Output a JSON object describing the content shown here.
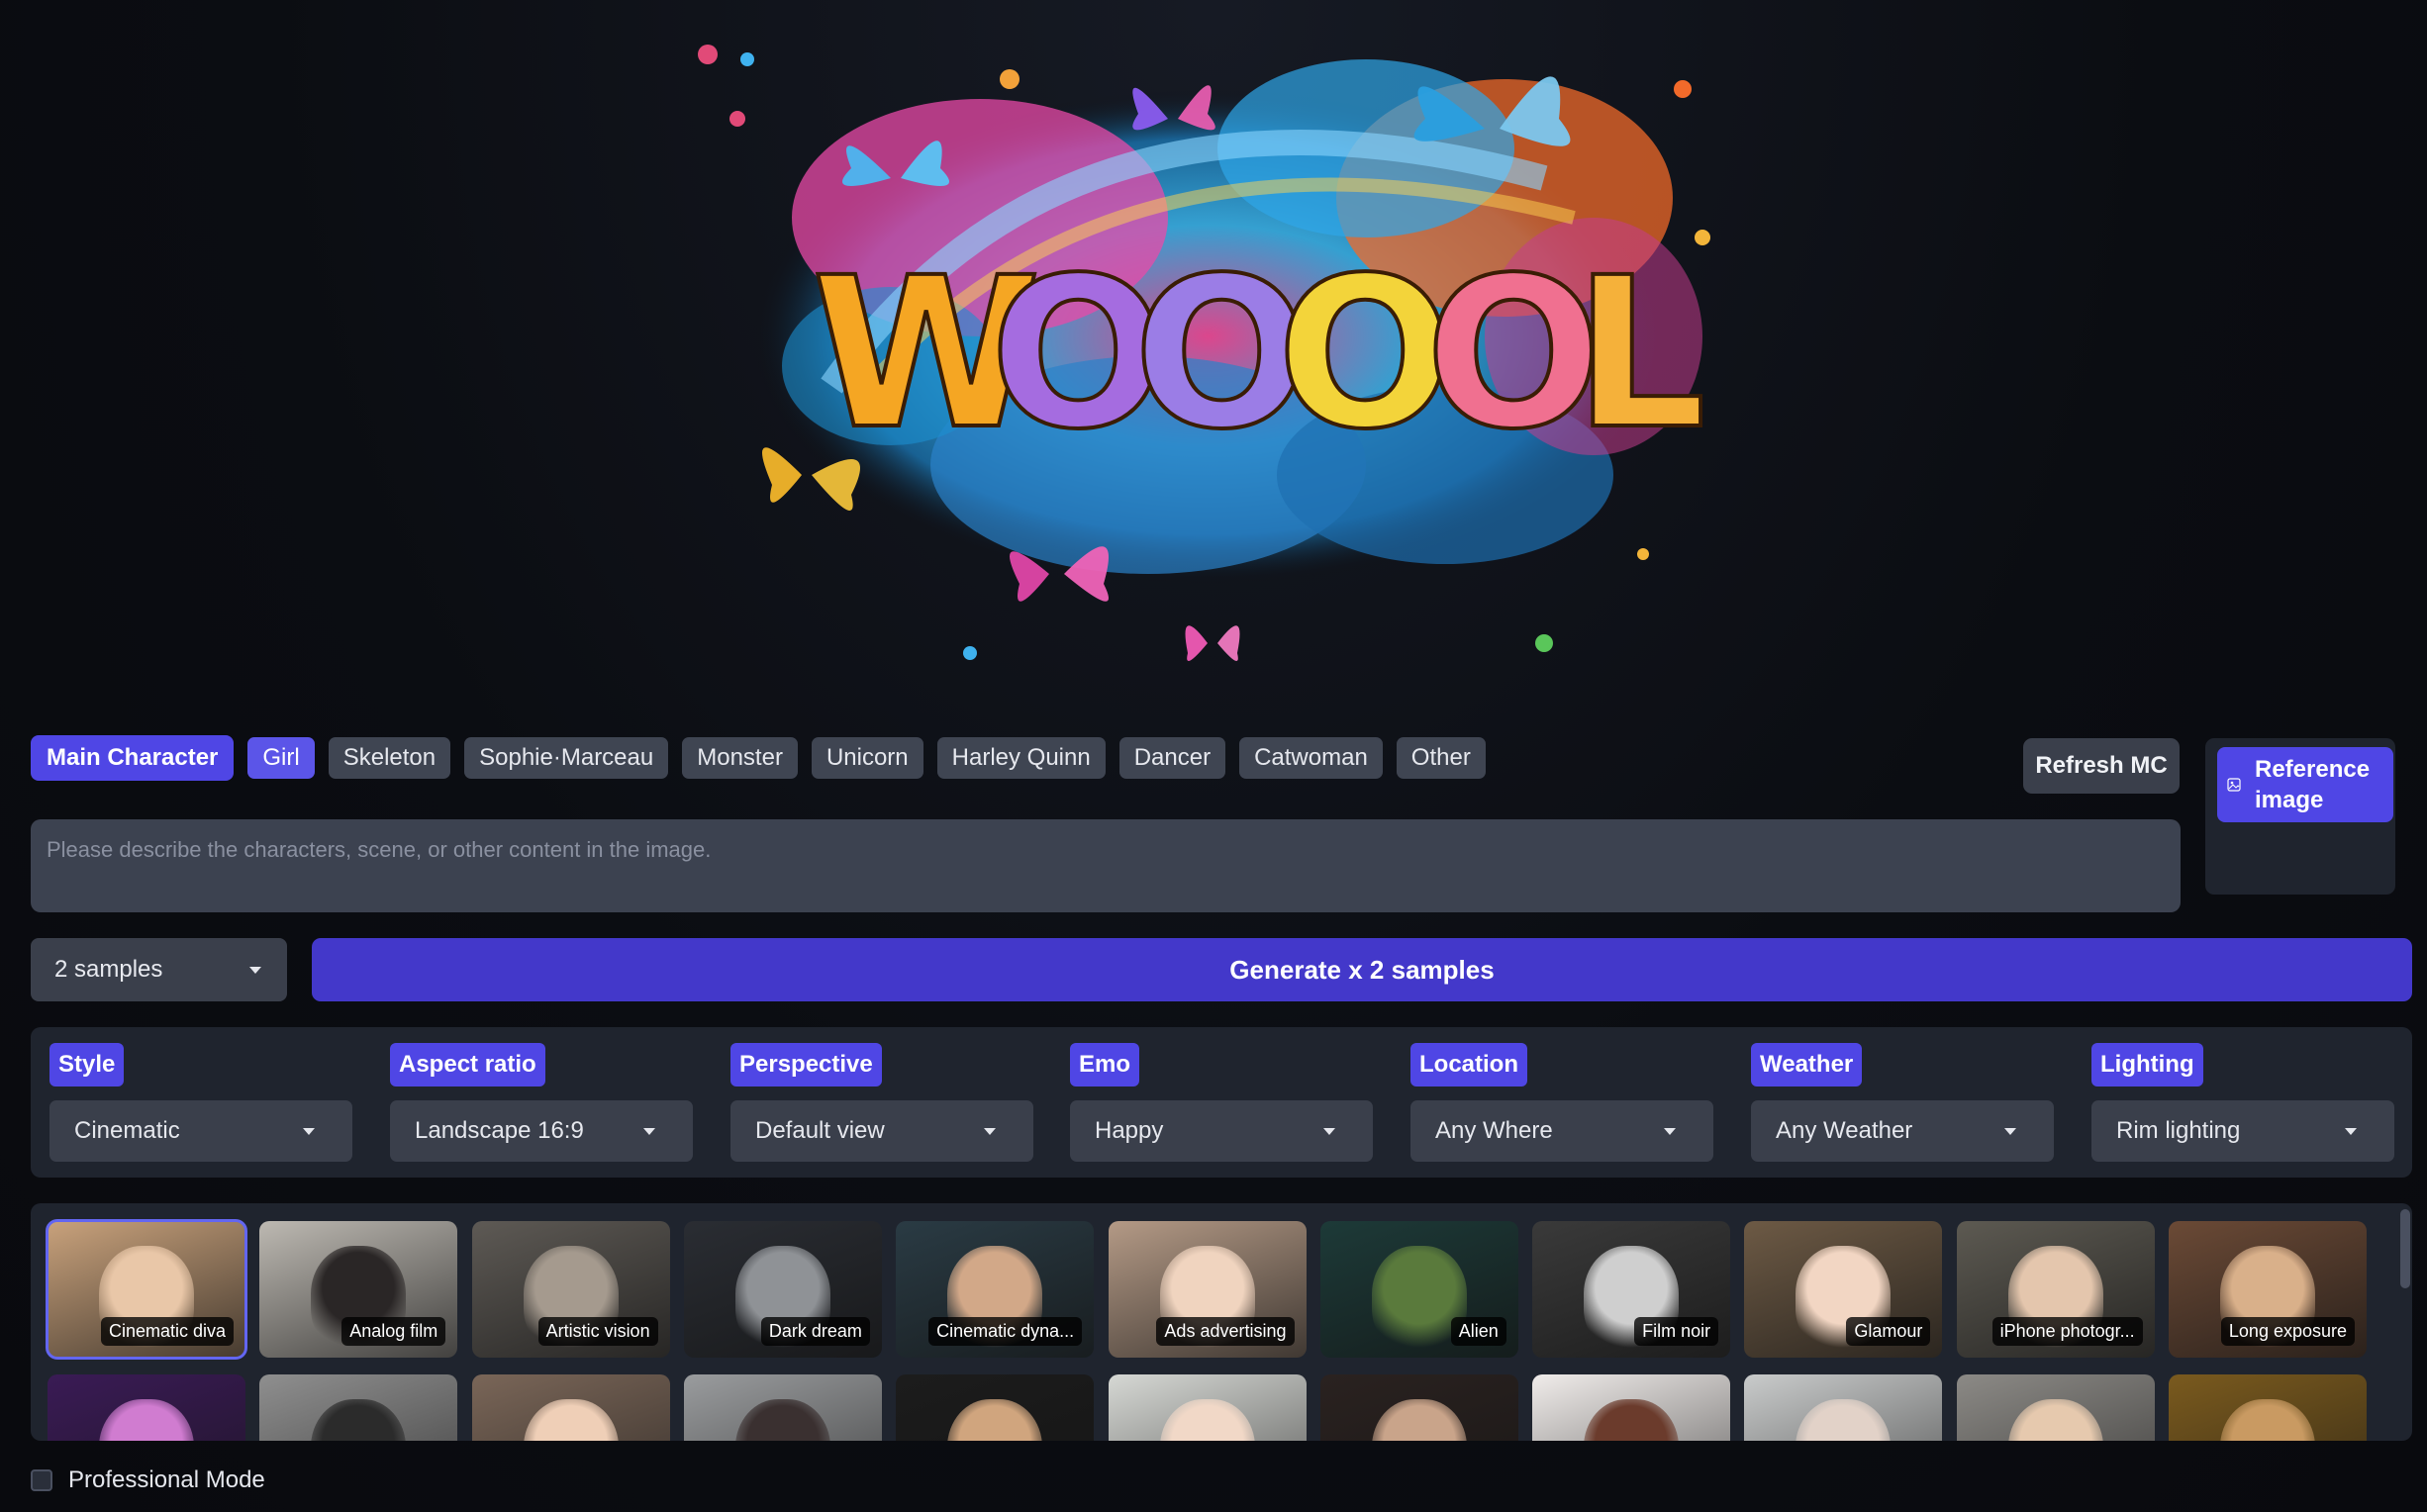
{
  "hero": {
    "logo_text": "WOOOOL"
  },
  "main_character": {
    "label": "Main Character",
    "chips": [
      "Girl",
      "Skeleton",
      "Sophie·Marceau",
      "Monster",
      "Unicorn",
      "Harley Quinn",
      "Dancer",
      "Catwoman",
      "Other"
    ],
    "active_index": 0,
    "refresh_label": "Refresh MC",
    "reference_label": "Reference image"
  },
  "prompt": {
    "placeholder": "Please describe the characters, scene, or other content in the image."
  },
  "generate": {
    "samples_value": "2 samples",
    "button_label": "Generate x 2 samples"
  },
  "options": [
    {
      "label": "Style",
      "value": "Cinematic"
    },
    {
      "label": "Aspect ratio",
      "value": "Landscape 16:9"
    },
    {
      "label": "Perspective",
      "value": "Default view"
    },
    {
      "label": "Emo",
      "value": "Happy"
    },
    {
      "label": "Location",
      "value": "Any Where"
    },
    {
      "label": "Weather",
      "value": "Any Weather"
    },
    {
      "label": "Lighting",
      "value": "Rim lighting"
    }
  ],
  "gallery": {
    "selected_index": 0,
    "row1": [
      {
        "caption": "Cinematic diva",
        "bg": "#c9a27c",
        "face": "#e9c7a8"
      },
      {
        "caption": "Analog film",
        "bg": "#bdb9b2",
        "face": "#2a2626"
      },
      {
        "caption": "Artistic vision",
        "bg": "#5e5a55",
        "face": "#a59a8e"
      },
      {
        "caption": "Dark dream",
        "bg": "#2a2d33",
        "face": "#8f9296"
      },
      {
        "caption": "Cinematic dyna...",
        "bg": "#2a3b44",
        "face": "#d2a888"
      },
      {
        "caption": "Ads advertising",
        "bg": "#b49a86",
        "face": "#f0d4bf"
      },
      {
        "caption": "Alien",
        "bg": "#1d3a38",
        "face": "#5a7a3c"
      },
      {
        "caption": "Film noir",
        "bg": "#3a3a3a",
        "face": "#cfcfcf"
      },
      {
        "caption": "Glamour",
        "bg": "#6d5a45",
        "face": "#f2d6c3"
      },
      {
        "caption": "iPhone photogr...",
        "bg": "#5d5a52",
        "face": "#e4c6ad"
      },
      {
        "caption": "Long exposure",
        "bg": "#6b4a36",
        "face": "#d9b08a"
      }
    ],
    "row2": [
      {
        "bg": "#3a1b55",
        "face": "#d07cd0"
      },
      {
        "bg": "#8f8f8f",
        "face": "#2b2b2b"
      },
      {
        "bg": "#7a6658",
        "face": "#efcfb7"
      },
      {
        "bg": "#9a9c9e",
        "face": "#3a3030"
      },
      {
        "bg": "#1c1c1c",
        "face": "#d0a57e"
      },
      {
        "bg": "#d6d8d4",
        "face": "#f1d8c7"
      },
      {
        "bg": "#2a2220",
        "face": "#c9a48a"
      },
      {
        "bg": "#f0ecea",
        "face": "#6b3b2c"
      },
      {
        "bg": "#c9cbcb",
        "face": "#e2d2c8"
      },
      {
        "bg": "#8c8a86",
        "face": "#e6c9ae"
      },
      {
        "bg": "#7a5a1e",
        "face": "#c99a62"
      }
    ]
  },
  "professional_mode": {
    "label": "Professional Mode",
    "checked": false
  }
}
